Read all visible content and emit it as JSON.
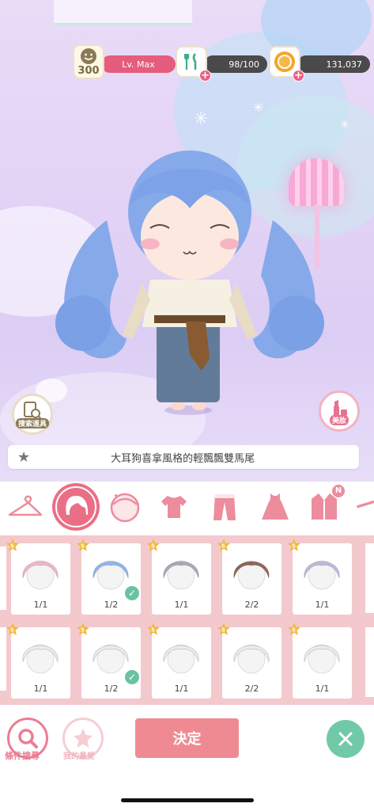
{
  "hud": {
    "smile_count": "300",
    "level": "Lv. Max",
    "food": "98/100",
    "coins": "131,037"
  },
  "scene_buttons": {
    "search_props": "搜索道具",
    "makeup": "美妝"
  },
  "item_description": "大耳狗喜拿風格的輕飄飄雙馬尾",
  "categories": [
    {
      "name": "hanger",
      "active": false
    },
    {
      "name": "hair",
      "active": true
    },
    {
      "name": "face",
      "active": false
    },
    {
      "name": "top",
      "active": false
    },
    {
      "name": "pants",
      "active": false
    },
    {
      "name": "dress",
      "active": false
    },
    {
      "name": "coat",
      "active": false,
      "badge": "N"
    }
  ],
  "items": [
    {
      "count": "1/1",
      "color": "#f6b3d0",
      "equipped": false
    },
    {
      "count": "1/2",
      "color": "#8fb6ef",
      "equipped": true
    },
    {
      "count": "1/1",
      "color": "#a9a8b9",
      "equipped": false
    },
    {
      "count": "2/2",
      "color": "#8e6652",
      "equipped": false
    },
    {
      "count": "1/1",
      "color": "#c4b7dd",
      "equipped": false
    },
    {
      "count": "1/1",
      "color": "#ececec",
      "equipped": false
    },
    {
      "count": "1/2",
      "color": "#ececec",
      "equipped": true
    },
    {
      "count": "1/1",
      "color": "#ececec",
      "equipped": false
    },
    {
      "count": "2/2",
      "color": "#ececec",
      "equipped": false
    },
    {
      "count": "1/1",
      "color": "#ececec",
      "equipped": false
    }
  ],
  "item_badge": "S",
  "bottom": {
    "search_label": "條件搜尋",
    "favorites_label": "我的最愛",
    "decide_label": "決定"
  },
  "colors": {
    "accent": "#ea6f86",
    "decide": "#ef8a92",
    "close": "#72c9a8",
    "grid_bg": "#f3c9cd"
  }
}
